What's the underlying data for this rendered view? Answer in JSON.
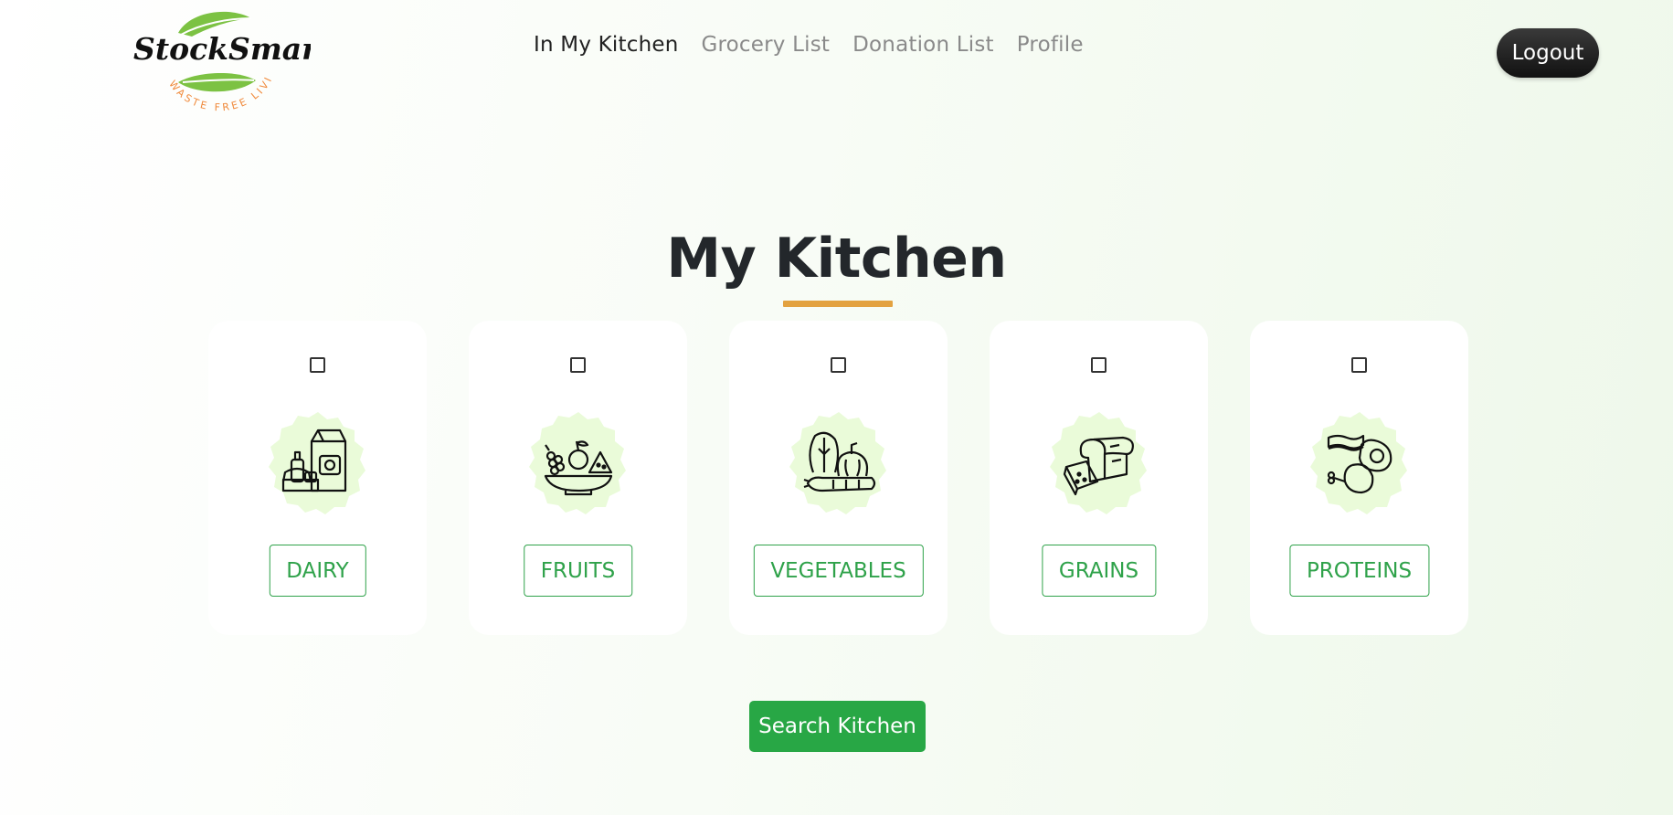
{
  "header": {
    "logo": {
      "brand_name": "StockSmart",
      "tagline": "WASTE FREE LIVING",
      "leaf_color": "#7cc243",
      "tagline_color": "#f08a3c"
    },
    "nav": [
      {
        "label": "In My Kitchen",
        "active": true
      },
      {
        "label": "Grocery List",
        "active": false
      },
      {
        "label": "Donation List",
        "active": false
      },
      {
        "label": "Profile",
        "active": false
      }
    ],
    "logout_label": "Logout"
  },
  "main": {
    "title": "My Kitchen",
    "accent_color": "#e3a240",
    "categories": [
      {
        "label": "DAIRY",
        "icon": "dairy-icon",
        "checked": false
      },
      {
        "label": "FRUITS",
        "icon": "fruits-icon",
        "checked": false
      },
      {
        "label": "VEGETABLES",
        "icon": "vegetables-icon",
        "checked": false
      },
      {
        "label": "GRAINS",
        "icon": "grains-icon",
        "checked": false
      },
      {
        "label": "PROTEINS",
        "icon": "proteins-icon",
        "checked": false
      }
    ],
    "search_label": "Search Kitchen",
    "button_color": "#28a745"
  }
}
